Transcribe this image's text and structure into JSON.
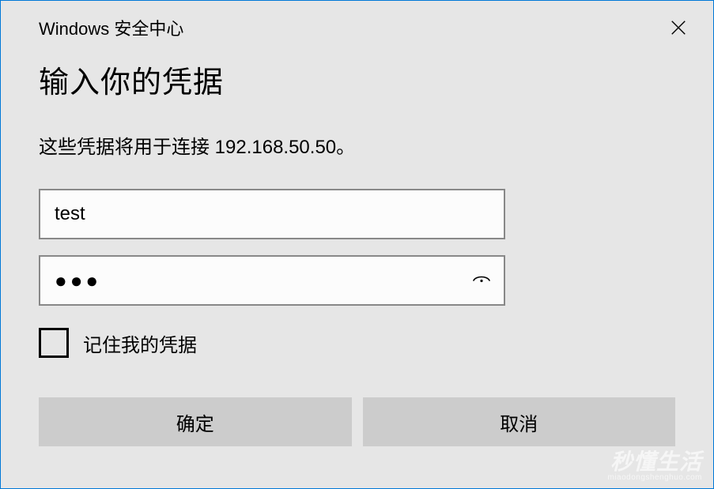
{
  "titlebar": {
    "text": "Windows 安全中心"
  },
  "heading": "输入你的凭据",
  "description": "这些凭据将用于连接 192.168.50.50。",
  "username": {
    "value": "test"
  },
  "password": {
    "masked": "●●●"
  },
  "remember": {
    "label": "记住我的凭据",
    "checked": false
  },
  "buttons": {
    "ok": "确定",
    "cancel": "取消"
  },
  "watermark": {
    "main": "秒懂生活",
    "sub": "miaodongshenghuo.com"
  }
}
